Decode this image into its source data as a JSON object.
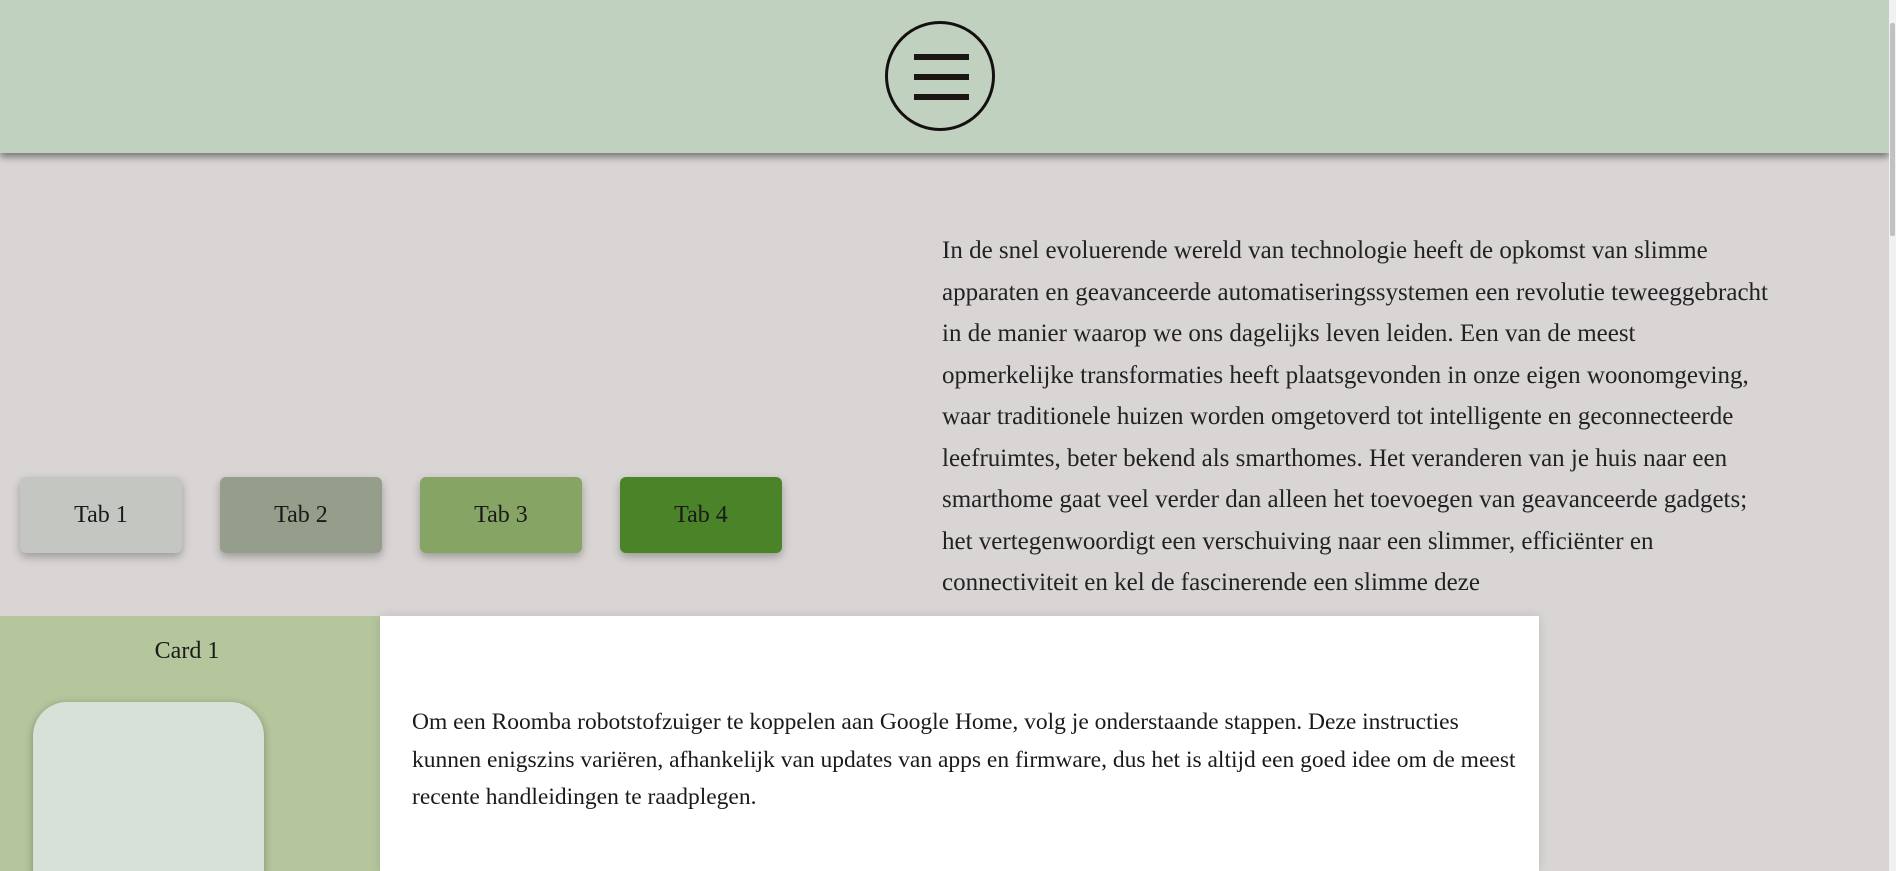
{
  "header": {
    "menu_icon": "hamburger-menu-icon"
  },
  "article": {
    "text": "In de snel evoluerende wereld van technologie heeft de opkomst van slimme apparaten en geavanceerde automatiseringssystemen een revolutie teweeggebracht in de manier waarop we ons dagelijks leven leiden. Een van de meest opmerkelijke transformaties heeft plaatsgevonden in onze eigen woonomgeving, waar traditionele huizen worden omgetoverd tot intelligente en geconnecteerde leefruimtes, beter bekend als smarthomes. Het veranderen van je huis naar een smarthome gaat veel verder dan alleen het toevoegen van geavanceerde gadgets; het vertegenwoordigt een verschuiving naar een slimmer, efficiënter en connectiviteit en kel de fascinerende een slimme deze"
  },
  "tabs": [
    {
      "label": "Tab 1"
    },
    {
      "label": "Tab 2"
    },
    {
      "label": "Tab 3"
    },
    {
      "label": "Tab 4"
    }
  ],
  "card": {
    "title": "Card 1"
  },
  "modal": {
    "text": "Om een Roomba robotstofzuiger te koppelen aan Google Home, volg je onderstaande stappen. Deze instructies kunnen enigszins variëren, afhankelijk van updates van apps en firmware, dus het is altijd een goed idee om de meest recente handleidingen te raadplegen."
  },
  "colors": {
    "header_bg": "#c0d1bf",
    "page_bg": "#d9d5d5",
    "tab1": "#c4c6c2",
    "tab2": "#959e8b",
    "tab3": "#86a463",
    "tab4": "#4b8329",
    "card_bg": "#b5c59c",
    "modal_bg": "#ffffff"
  }
}
